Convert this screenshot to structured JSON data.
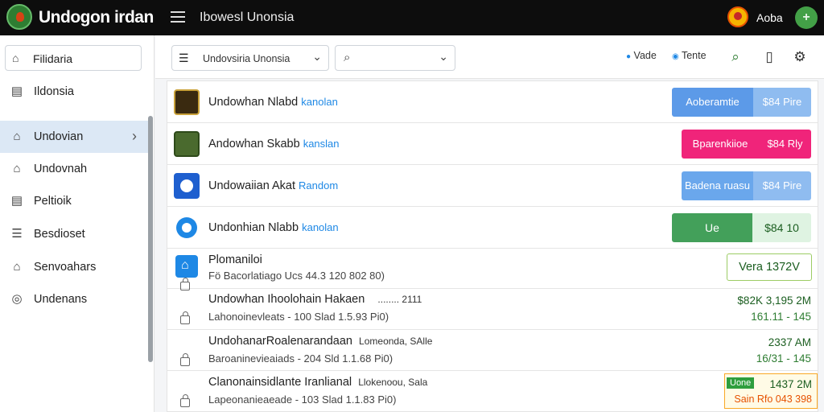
{
  "app": {
    "title": "Undogon irdan",
    "page": "Ibowesl Unonsia",
    "user": "Aoba",
    "fab": "+"
  },
  "sidebar": {
    "search_value": "Filidaria",
    "items": [
      {
        "label": "Ildonsia",
        "icon": "calendar-icon"
      },
      {
        "label": "Undovian",
        "icon": "home-icon",
        "active": true
      },
      {
        "label": "Undovnah",
        "icon": "home-icon"
      },
      {
        "label": "Peltioik",
        "icon": "calendar-icon"
      },
      {
        "label": "Besdioset",
        "icon": "list-icon"
      },
      {
        "label": "Senvoahars",
        "icon": "home-icon"
      },
      {
        "label": "Undenans",
        "icon": "settings-icon"
      }
    ]
  },
  "toolbar": {
    "select_value": "Undovsiria Unonsia",
    "search_value": "",
    "filter1": "Vade",
    "filter2": "Tente"
  },
  "rows": [
    {
      "title": "Undowhan Nlabd",
      "tag": "kanolan",
      "pill_left": "Aoberamtie",
      "pill_right": "$84 Pire",
      "color_left": "#5c9ae8",
      "color_right": "#8fbcf0"
    },
    {
      "title": "Andowhan Skabb",
      "tag": "kanslan",
      "pill_left": "Bparenkiioe",
      "pill_right": "$84 Rly",
      "color_left": "#f0247a",
      "color_right": "#f0247a"
    },
    {
      "title": "Undowaiian Akat",
      "tag": "Random",
      "pill_left": "Badena ruasu",
      "pill_right": "$84 Pire",
      "color_left": "#6aa7ec",
      "color_right": "#8fbcf0"
    },
    {
      "title": "Undonhian Nlabb",
      "tag": "kanolan",
      "pill_left": "Ue",
      "pill_right": "$84 10",
      "color_left": "#43a05a",
      "color_right": "#dff3e2"
    }
  ],
  "detail_row": {
    "title": "Plomaniloi",
    "sub": "Fö Bacorlatiago Ucs 44.3 120 802 80)",
    "button": "Vera  1372V"
  },
  "tx_rows": [
    {
      "title": "Undowhan Ihoolohain Hakaen",
      "dots": "........ 2111",
      "sub": "Lahonoinevleats - 100 Slad 1.5.93 Pi0)",
      "amount": "$82K 3,195 2M",
      "amount2": "161.11 - 145"
    },
    {
      "title": "UndohanarRoalenarandaan",
      "dots": "Lomeonda, SAlle",
      "sub": "Baroaninevieaiads - 204 Sld 1.1.68 Pi0)",
      "amount": "2337 AM",
      "amount2": "16/31 - 145"
    },
    {
      "title": "Clanonainsidlante Iranlianal",
      "dots": "Llokenoou, Sala",
      "sub": "Lapeonanieaeade - 103 Slad 1.1.83 Pi0)",
      "amount": "1437 2M",
      "badge": "Uone",
      "amount2": "Sain Rfo 043 398"
    }
  ]
}
